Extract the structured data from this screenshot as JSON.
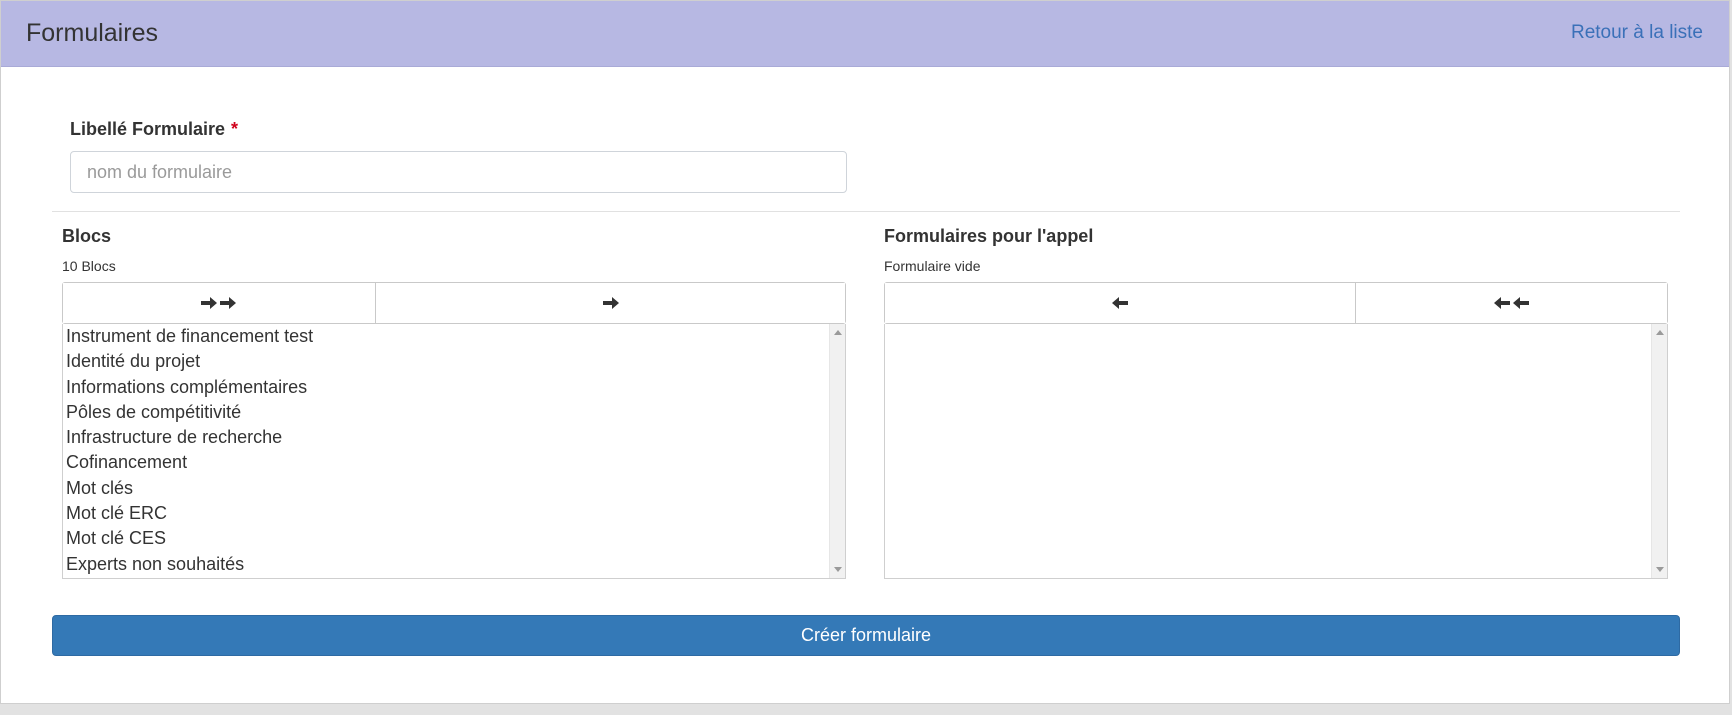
{
  "header": {
    "title": "Formulaires",
    "back_link": "Retour à la liste"
  },
  "form": {
    "label": "Libellé Formulaire",
    "required_mark": "*",
    "input_placeholder": "nom du formulaire",
    "input_value": ""
  },
  "blocs": {
    "title": "Blocs",
    "subtitle": "10 Blocs",
    "items": [
      "Instrument de financement test",
      "Identité du projet",
      "Informations complémentaires",
      "Pôles de compétitivité",
      "Infrastructure de recherche",
      "Cofinancement",
      "Mot clés",
      "Mot clé ERC",
      "Mot clé CES",
      "Experts non souhaités"
    ]
  },
  "selected": {
    "title": "Formulaires pour l'appel",
    "subtitle": "Formulaire vide",
    "items": []
  },
  "buttons": {
    "move_all_right_icon": "double-arrow-right-icon",
    "move_right_icon": "arrow-right-icon",
    "move_left_icon": "arrow-left-icon",
    "move_all_left_icon": "double-arrow-left-icon",
    "create_label": "Créer formulaire"
  },
  "colors": {
    "header_bg": "#b7b8e3",
    "link": "#3a70b8",
    "primary_button": "#3479b7",
    "required": "#d0021b"
  }
}
